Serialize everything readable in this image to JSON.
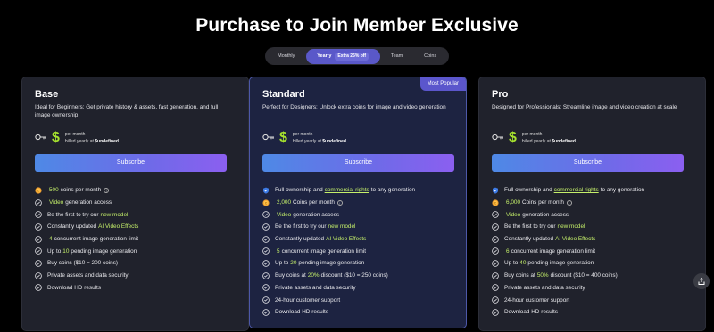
{
  "header": {
    "title": "Purchase to Join Member Exclusive"
  },
  "billing_toggle": {
    "monthly": "Monthly",
    "yearly": "Yearly",
    "yearly_discount": "Extra 26% off",
    "team": "Team",
    "coins": "Coins"
  },
  "colors": {
    "accent": "#5b56cc",
    "highlight": "#c5f06a",
    "price": "#a6e22e"
  },
  "plans": {
    "base": {
      "name": "Base",
      "desc": "Ideal for Beginners: Get private history & assets, fast generation, and full image ownership",
      "price_old": "$—",
      "price_symbol": "$",
      "per_month": "per month",
      "billed_prefix": "billed yearly at",
      "billed_value": "$undefined",
      "subscribe": "Subscribe",
      "features": [
        {
          "icon": "coin-icon",
          "parts": [
            [
              "hl",
              "500"
            ],
            [
              "t",
              " coins per month"
            ]
          ],
          "info": true
        },
        {
          "icon": "check-icon",
          "parts": [
            [
              "hl",
              "Video"
            ],
            [
              "t",
              " generation access"
            ]
          ]
        },
        {
          "icon": "check-icon",
          "parts": [
            [
              "t",
              "Be the first to try our "
            ],
            [
              "hl",
              "new model"
            ]
          ]
        },
        {
          "icon": "check-icon",
          "parts": [
            [
              "t",
              "Constantly updated "
            ],
            [
              "hl",
              "AI Video Effects"
            ]
          ]
        },
        {
          "icon": "check-icon",
          "parts": [
            [
              "hl",
              "4"
            ],
            [
              "t",
              " concurrent image generation limit"
            ]
          ]
        },
        {
          "icon": "check-icon",
          "parts": [
            [
              "t",
              "Up to "
            ],
            [
              "hl",
              "10"
            ],
            [
              "t",
              " pending image generation"
            ]
          ]
        },
        {
          "icon": "check-icon",
          "parts": [
            [
              "t",
              "Buy coins ($10 = 200 coins)"
            ]
          ]
        },
        {
          "icon": "check-icon",
          "parts": [
            [
              "t",
              "Private assets and data security"
            ]
          ]
        },
        {
          "icon": "check-icon",
          "parts": [
            [
              "t",
              "Download HD results"
            ]
          ]
        }
      ]
    },
    "standard": {
      "name": "Standard",
      "badge": "Most Popular",
      "desc": "Perfect for Designers: Unlock extra coins for image and video generation",
      "price_old": "$—",
      "price_symbol": "$",
      "per_month": "per month",
      "billed_prefix": "billed yearly at",
      "billed_value": "$undefined",
      "subscribe": "Subscribe",
      "features": [
        {
          "icon": "shield-icon",
          "parts": [
            [
              "t",
              "Full ownership and "
            ],
            [
              "hlu",
              "commercial rights"
            ],
            [
              "t",
              " to any generation"
            ]
          ]
        },
        {
          "icon": "coin-icon",
          "parts": [
            [
              "hl",
              "2,000"
            ],
            [
              "t",
              " Coins per month"
            ]
          ],
          "info": true
        },
        {
          "icon": "check-icon",
          "parts": [
            [
              "hl",
              "Video"
            ],
            [
              "t",
              " generation access"
            ]
          ]
        },
        {
          "icon": "check-icon",
          "parts": [
            [
              "t",
              "Be the first to try our "
            ],
            [
              "hl",
              "new model"
            ]
          ]
        },
        {
          "icon": "check-icon",
          "parts": [
            [
              "t",
              "Constantly updated "
            ],
            [
              "hl",
              "AI Video Effects"
            ]
          ]
        },
        {
          "icon": "check-icon",
          "parts": [
            [
              "hl",
              "5"
            ],
            [
              "t",
              " concurrent image generation limit"
            ]
          ]
        },
        {
          "icon": "check-icon",
          "parts": [
            [
              "t",
              "Up to "
            ],
            [
              "hl",
              "20"
            ],
            [
              "t",
              " pending image generation"
            ]
          ]
        },
        {
          "icon": "check-icon",
          "parts": [
            [
              "t",
              "Buy coins at "
            ],
            [
              "hl",
              "20%"
            ],
            [
              "t",
              " discount ($10 = 250 coins)"
            ]
          ]
        },
        {
          "icon": "check-icon",
          "parts": [
            [
              "t",
              "Private assets and data security"
            ]
          ]
        },
        {
          "icon": "check-icon",
          "parts": [
            [
              "t",
              "24-hour customer support"
            ]
          ]
        },
        {
          "icon": "check-icon",
          "parts": [
            [
              "t",
              "Download HD results"
            ]
          ]
        }
      ]
    },
    "pro": {
      "name": "Pro",
      "desc": "Designed for Professionals: Streamline image and video creation at scale",
      "price_old": "$—",
      "price_symbol": "$",
      "per_month": "per month",
      "billed_prefix": "billed yearly at",
      "billed_value": "$undefined",
      "subscribe": "Subscribe",
      "features": [
        {
          "icon": "shield-icon",
          "parts": [
            [
              "t",
              "Full ownership and "
            ],
            [
              "hlu",
              "commercial rights"
            ],
            [
              "t",
              " to any generation"
            ]
          ]
        },
        {
          "icon": "coin-icon",
          "parts": [
            [
              "hl",
              "6,000"
            ],
            [
              "t",
              " Coins per month"
            ]
          ],
          "info": true
        },
        {
          "icon": "check-icon",
          "parts": [
            [
              "hl",
              "Video"
            ],
            [
              "t",
              " generation access"
            ]
          ]
        },
        {
          "icon": "check-icon",
          "parts": [
            [
              "t",
              "Be the first to try our "
            ],
            [
              "hl",
              "new model"
            ]
          ]
        },
        {
          "icon": "check-icon",
          "parts": [
            [
              "t",
              "Constantly updated "
            ],
            [
              "hl",
              "AI Video Effects"
            ]
          ]
        },
        {
          "icon": "check-icon",
          "parts": [
            [
              "hl",
              "6"
            ],
            [
              "t",
              " concurrent image generation limit"
            ]
          ]
        },
        {
          "icon": "check-icon",
          "parts": [
            [
              "t",
              "Up to "
            ],
            [
              "hl",
              "40"
            ],
            [
              "t",
              " pending image generation"
            ]
          ]
        },
        {
          "icon": "check-icon",
          "parts": [
            [
              "t",
              "Buy coins at "
            ],
            [
              "hl",
              "50%"
            ],
            [
              "t",
              " discount ($10 = 400 coins)"
            ]
          ]
        },
        {
          "icon": "check-icon",
          "parts": [
            [
              "t",
              "Private assets and data security"
            ]
          ]
        },
        {
          "icon": "check-icon",
          "parts": [
            [
              "t",
              "24-hour customer support"
            ]
          ]
        },
        {
          "icon": "check-icon",
          "parts": [
            [
              "t",
              "Download HD results"
            ]
          ]
        }
      ]
    }
  }
}
